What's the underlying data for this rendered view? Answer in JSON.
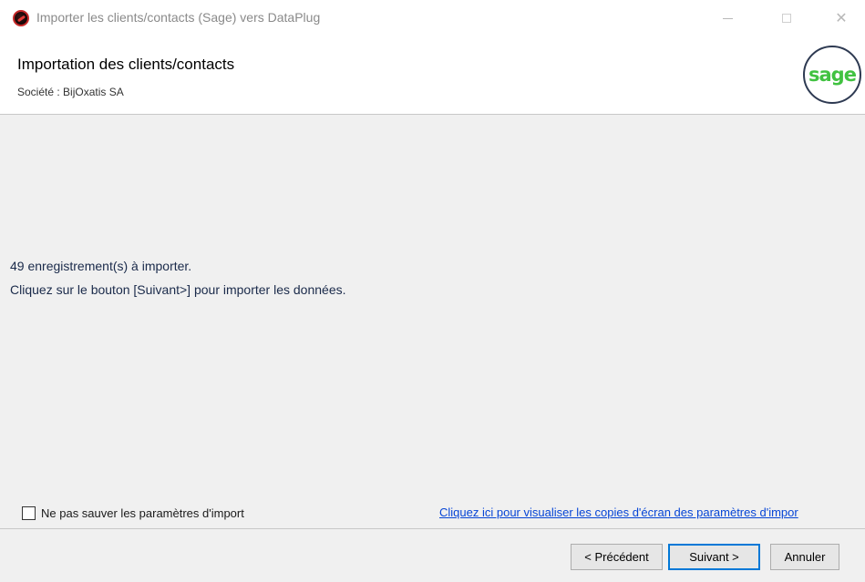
{
  "window": {
    "title": "Importer les clients/contacts (Sage) vers DataPlug",
    "controls": [
      "minimize",
      "maximize",
      "close"
    ]
  },
  "header": {
    "title": "Importation des clients/contacts",
    "subtitle": "Société : BijOxatis SA",
    "logo_text": "sage",
    "logo_color": "#41c241"
  },
  "main": {
    "message_count": "49 enregistrement(s) à importer.",
    "message_instruction": "Cliquez sur le bouton [Suivant>] pour importer les données."
  },
  "options": {
    "checkbox_label": "Ne pas sauver les paramètres d'import",
    "checkbox_checked": false,
    "link_text": "Cliquez ici pour visualiser les copies d'écran des paramètres d'impor"
  },
  "footer": {
    "prev_label": "< Précédent",
    "next_label": "Suivant >",
    "cancel_label": "Annuler"
  },
  "colors": {
    "link": "#0645d6",
    "focus_border": "#0078d7"
  }
}
